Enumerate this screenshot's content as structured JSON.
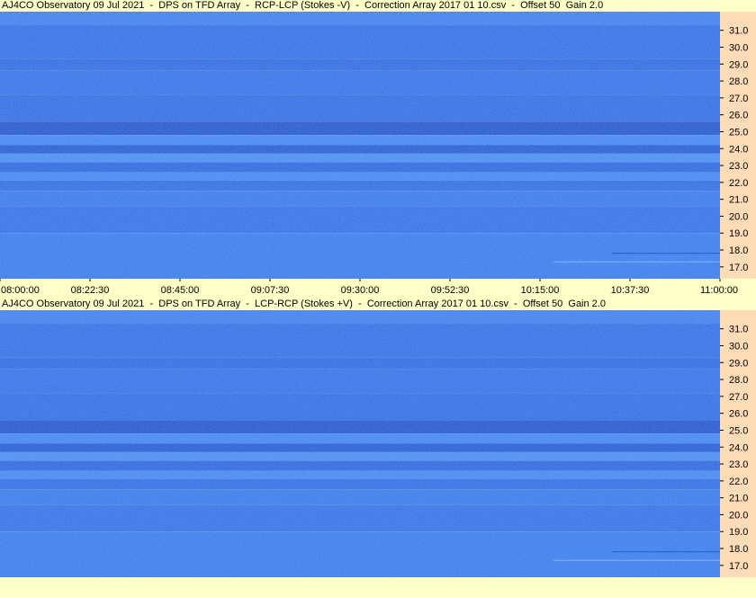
{
  "panels": [
    {
      "title": "AJ4CO Observatory 09 Jul 2021  -  DPS on TFD Array  -  RCP-LCP (Stokes -V)  -  Correction Array 2017 01 10.csv  -  Offset 50  Gain 2.0"
    },
    {
      "title": "AJ4CO Observatory 09 Jul 2021  -  DPS on TFD Array  -  LCP-RCP (Stokes +V)  -  Correction Array 2017 01 10.csv  -  Offset 50  Gain 2.0"
    }
  ],
  "chart_data": {
    "type": "heatmap",
    "x_ticks": [
      "08:00:00",
      "08:22:30",
      "08:45:00",
      "09:07:30",
      "09:30:00",
      "09:52:30",
      "10:15:00",
      "10:37:30",
      "11:00:00"
    ],
    "y_ticks": [
      "31.0",
      "30.0",
      "29.0",
      "28.0",
      "27.0",
      "26.0",
      "25.0",
      "24.0",
      "23.0",
      "22.0",
      "21.0",
      "20.0",
      "19.0",
      "18.0",
      "17.0"
    ],
    "y_tick_values": [
      31,
      30,
      29,
      28,
      27,
      26,
      25,
      24,
      23,
      22,
      21,
      20,
      19,
      18,
      17
    ],
    "y_range": [
      16.3,
      32.1
    ],
    "colors": {
      "base": "#2f6de6",
      "dark_band": "#1f55cf",
      "light_band": "#4a8af0",
      "plot_bg_label": "#ffdcb8",
      "page_bg": "#ffffc8"
    }
  }
}
